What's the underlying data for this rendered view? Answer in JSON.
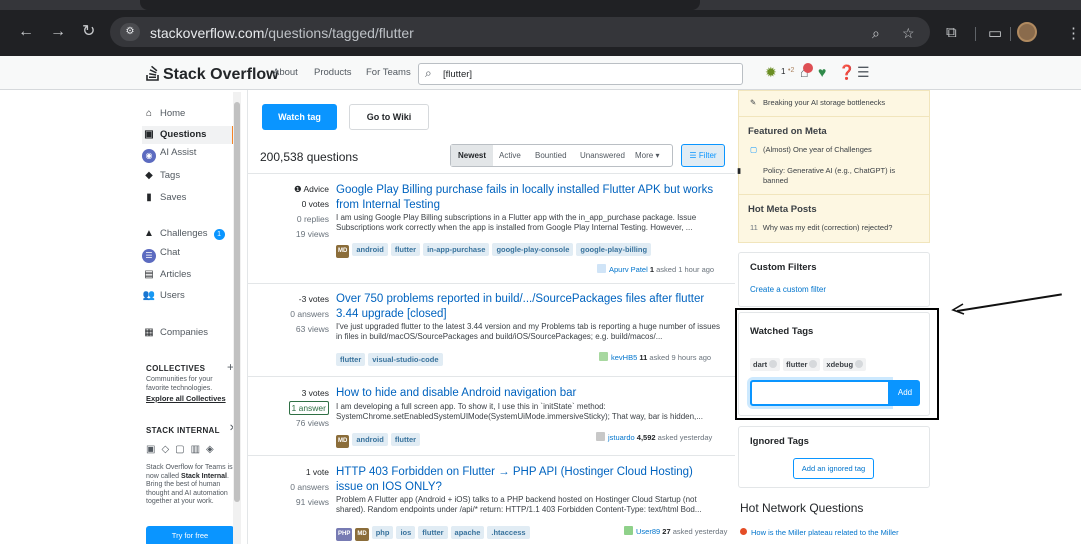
{
  "browser": {
    "url_domain": "stackoverflow.com",
    "url_path": "/questions/tagged/flutter"
  },
  "topbar": {
    "logo": "Stack Overflow",
    "links": [
      "About",
      "Products",
      "For Teams"
    ],
    "search_value": "[flutter]",
    "reputation": "1",
    "bronze": "•2"
  },
  "leftnav": {
    "items": [
      "Home",
      "Questions",
      "AI Assist",
      "Tags",
      "Saves",
      "Challenges",
      "Chat",
      "Articles",
      "Users",
      "Companies"
    ],
    "challenges_badge": "1",
    "collectives_heading": "COLLECTIVES",
    "collectives_text": "Communities for your favorite technologies.",
    "collectives_link": "Explore all Collectives",
    "internal_heading": "STACK INTERNAL",
    "internal_text_a": "Stack Overflow for Teams is now called ",
    "internal_text_b": "Stack Internal",
    "internal_text_c": ". Bring the best of human thought and AI automation together at your work.",
    "try_button": "Try for free"
  },
  "main": {
    "watch_tag": "Watch tag",
    "go_to_wiki": "Go to Wiki",
    "question_count": "200,538 questions",
    "sort_tabs": [
      "Newest",
      "Active",
      "Bountied",
      "Unanswered",
      "More ▾"
    ],
    "filter_label": "Filter",
    "questions": [
      {
        "prefix": "Advice",
        "votes": "0 votes",
        "answers": "0 replies",
        "views": "19 views",
        "title": "Google Play Billing purchase fails in locally installed Flutter APK but works from Internal Testing",
        "excerpt": "I am using Google Play Billing subscriptions in a Flutter app with the in_app_purchase package. Issue Subscriptions work correctly when the app is installed from Google Play Internal Testing. However, ...",
        "tags": [
          "android",
          "flutter",
          "in-app-purchase",
          "google-play-console",
          "google-play-billing"
        ],
        "tag_icon": "MD",
        "user": "Apurv Patel",
        "rep": "1",
        "time": "asked 1 hour ago"
      },
      {
        "votes": "-3 votes",
        "answers": "0 answers",
        "views": "63 views",
        "title": "Over 750 problems reported in build/.../SourcePackages files after flutter 3.44 upgrade [closed]",
        "excerpt": "I've just upgraded flutter to the latest 3.44 version and my Problems tab is reporting a huge number of issues in files in build/macOS/SourcePackages and build/iOS/SourcePackages; e.g. build/macos/...",
        "tags": [
          "flutter",
          "visual-studio-code"
        ],
        "user": "kevHB5",
        "rep": "11",
        "time": "asked 9 hours ago"
      },
      {
        "votes": "3 votes",
        "answers": "1 answer",
        "views": "76 views",
        "title": "How to hide and disable Android navigation bar",
        "excerpt": "I am developing a full screen app. To show it, I use this in `initState` method: SystemChrome.setEnabledSystemUIMode(SystemUiMode.immersiveSticky); That way, bar is hidden,...",
        "tags": [
          "android",
          "flutter"
        ],
        "tag_icon": "MD",
        "user": "jstuardo",
        "rep": "4,592",
        "time": "asked yesterday"
      },
      {
        "votes": "1 vote",
        "answers": "0 answers",
        "views": "91 views",
        "title": "HTTP 403 Forbidden on Flutter → PHP API (Hostinger Cloud Hosting) issue on IOS ONLY?",
        "excerpt": "Problem A Flutter app (Android + iOS) talks to a PHP backend hosted on Hostinger Cloud Startup (not shared). Random endpoints under /api/* return: HTTP/1.1 403 Forbidden Content-Type: text/html Bod...",
        "tags": [
          "php",
          "ios",
          "flutter",
          "apache",
          ".htaccess"
        ],
        "tag_icon": "MD",
        "tag_icon2": "PHP",
        "user": "User89",
        "rep": "27",
        "time": "asked yesterday"
      }
    ]
  },
  "right": {
    "blog_item": "Breaking your AI storage bottlenecks",
    "featured_heading": "Featured on Meta",
    "featured_items": [
      "(Almost) One year of Challenges",
      "Policy: Generative AI (e.g., ChatGPT) is banned"
    ],
    "hot_meta_heading": "Hot Meta Posts",
    "hot_meta_count": "11",
    "hot_meta_item": "Why was my edit (correction) rejected?",
    "custom_filters_heading": "Custom Filters",
    "custom_filters_link": "Create a custom filter",
    "watched_heading": "Watched Tags",
    "watched_tags": [
      "dart",
      "flutter",
      "xdebug"
    ],
    "add_label": "Add",
    "ignored_heading": "Ignored Tags",
    "ignored_button": "Add an ignored tag",
    "hnq_heading": "Hot Network Questions",
    "hnq_item": "How is the Miller plateau related to the Miller"
  }
}
